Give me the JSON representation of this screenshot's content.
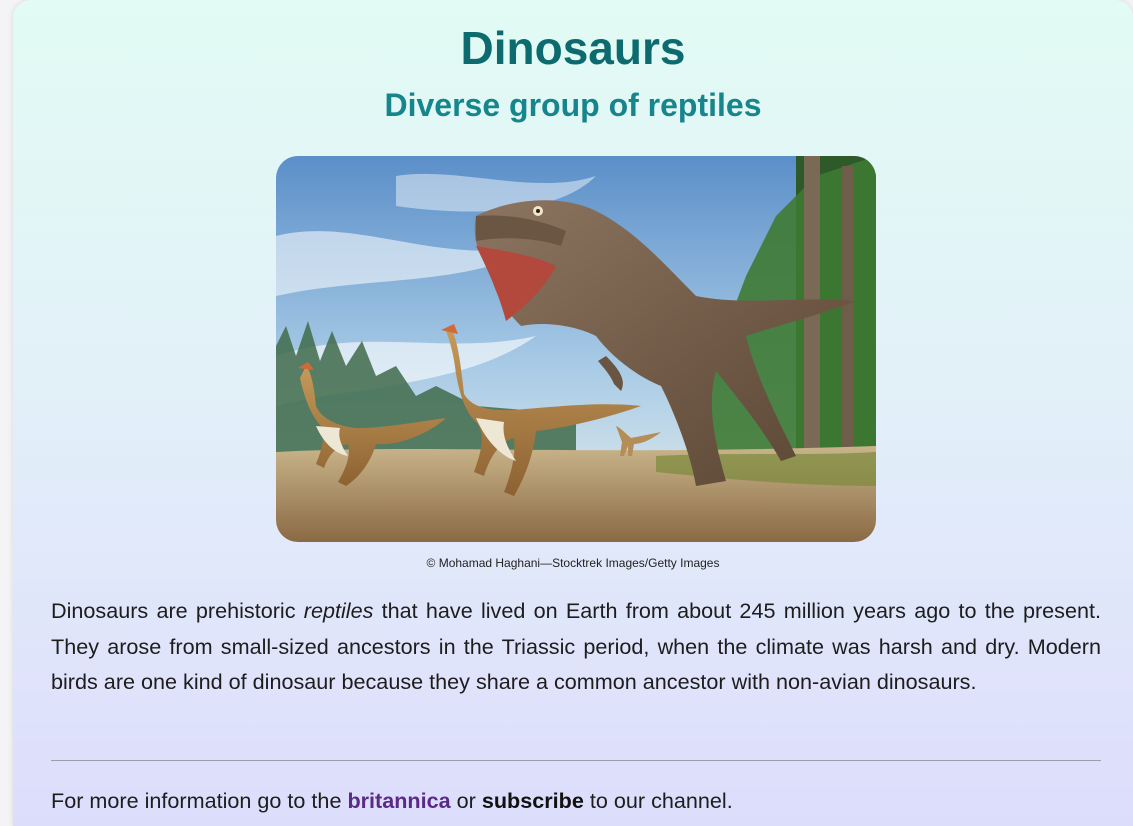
{
  "page": {
    "title": "Dinosaurs",
    "subtitle": "Diverse group of reptiles"
  },
  "figure": {
    "credit": "© Mohamad Haghani—Stocktrek Images/Getty Images"
  },
  "body": {
    "para_before": "Dinosaurs are prehistoric ",
    "para_emph": "reptiles",
    "para_after": " that have lived on Earth from about 245 million years ago to the present. They arose from small-sized ancestors in the Triassic period, when the climate was harsh and dry. Modern birds are one kind of dinosaur because they share a common ancestor with non-avian dinosaurs."
  },
  "footer": {
    "text_1": "For more information go to the ",
    "link_label": "britannica",
    "text_2": " or ",
    "subscribe_label": "subscribe",
    "text_3": " to our channel."
  },
  "colors": {
    "title": "#0d6a6f",
    "subtitle": "#17858c",
    "link": "#5b2a86"
  }
}
